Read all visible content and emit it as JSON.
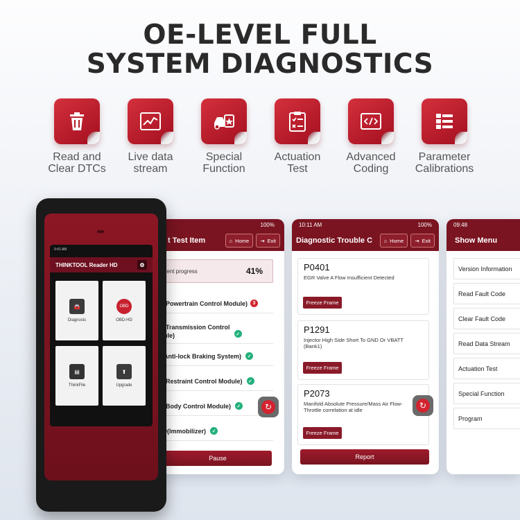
{
  "headline": {
    "line1": "OE-LEVEL FULL",
    "line2": "SYSTEM DIAGNOSTICS"
  },
  "features": [
    {
      "icon": "trash-icon",
      "line1": "Read and",
      "line2": "Clear DTCs"
    },
    {
      "icon": "chart-line-icon",
      "line1": "Live data",
      "line2": "stream"
    },
    {
      "icon": "car-star-icon",
      "line1": "Special",
      "line2": "Function"
    },
    {
      "icon": "checklist-icon",
      "line1": "Actuation",
      "line2": "Test"
    },
    {
      "icon": "code-icon",
      "line1": "Advanced",
      "line2": "Coding"
    },
    {
      "icon": "list-icon",
      "line1": "Parameter",
      "line2": "Calibrations"
    }
  ],
  "colors": {
    "brand_red": "#7a1421",
    "accent_red": "#c8202e",
    "ok_green": "#22b07b"
  },
  "device": {
    "app_title": "THINKTOOL Reader HD",
    "status_time": "9:41 AM",
    "tiles": [
      "Diagnosis",
      "OBD-HD",
      "ThinkFile",
      "Upgrade"
    ],
    "obd_badge": "OBD"
  },
  "screen1": {
    "battery": "100%",
    "title": "t Test Item",
    "home_label": "Home",
    "exit_label": "Exit",
    "progress_label": "rrent progress",
    "progress_value": "41%",
    "rows": [
      {
        "label": "(Powertrain Control Module)",
        "badge": "3",
        "status": "error"
      },
      {
        "label": "(Transmission Control",
        "label2": "ule)",
        "status": "ok"
      },
      {
        "label": "Anti-lock Braking System)",
        "status": "ok"
      },
      {
        "label": "(Restraint Control Module)",
        "status": "ok"
      },
      {
        "label": "(Body Control Module)",
        "status": "ok"
      },
      {
        "label": "0(Immobilizer)",
        "status": "ok"
      }
    ],
    "pause_label": "Pause"
  },
  "screen2": {
    "time": "10:11 AM",
    "battery": "100%",
    "title": "Diagnostic Trouble C",
    "home_label": "Home",
    "exit_label": "Exit",
    "dtcs": [
      {
        "code": "P0401",
        "desc": "EGR Valve A Flow Insufficient Detected"
      },
      {
        "code": "P1291",
        "desc": "Injector High Side Short To GND Or VBATT (Bank1)"
      },
      {
        "code": "P2073",
        "desc": "Manifold Absolute Pressure/Mass Air Flow-Throttle correlation at idle"
      }
    ],
    "freeze_label": "Freeze Frame",
    "report_label": "Report"
  },
  "screen3": {
    "time": "09:48",
    "title": "Show Menu",
    "items": [
      "Version Information",
      "Read Fault Code",
      "Clear Fault Code",
      "Read Data Stream",
      "Actuation Test",
      "Special Function",
      "Program"
    ]
  }
}
